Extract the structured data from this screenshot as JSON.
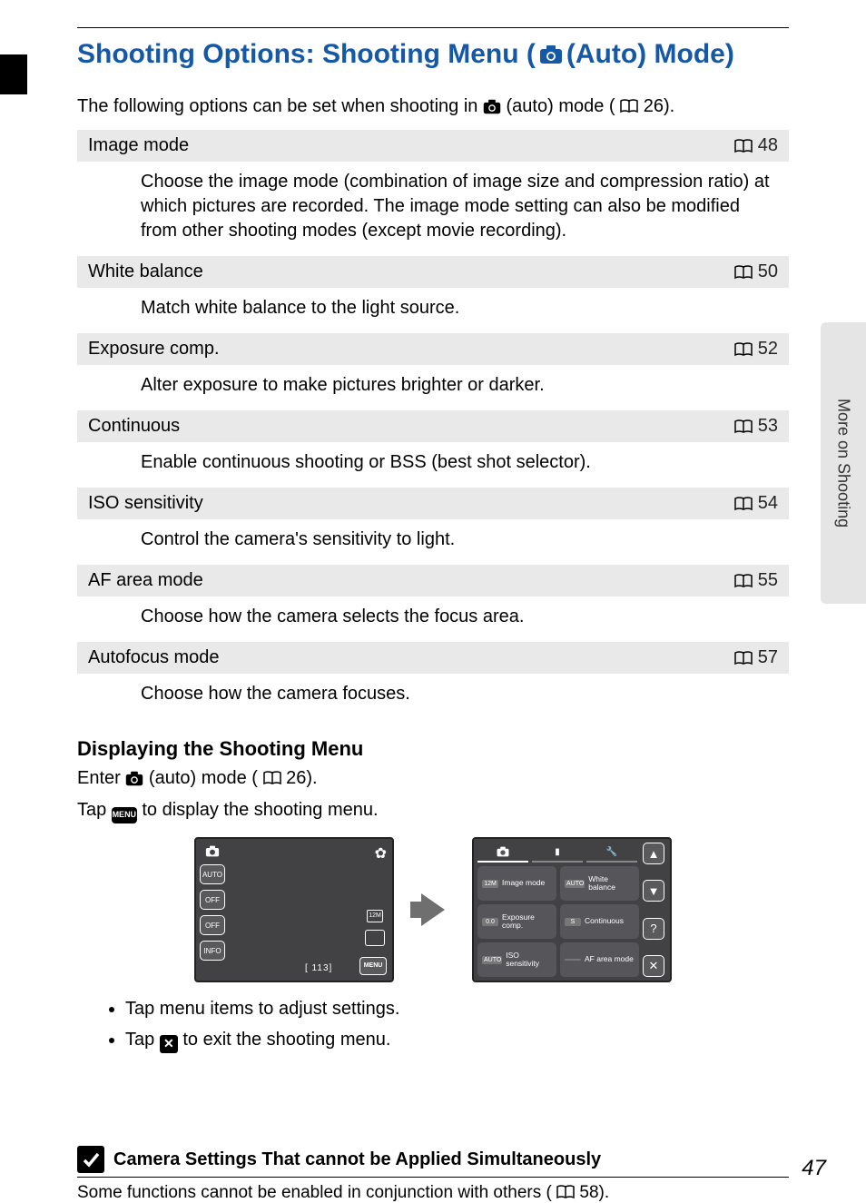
{
  "side_tab": "More on Shooting",
  "title_a": "Shooting Options: Shooting Menu (",
  "title_b": " (Auto) Mode)",
  "intro_a": "The following options can be set when shooting in ",
  "intro_b": " (auto) mode (",
  "intro_c": " 26).",
  "rows": [
    {
      "label": "Image mode",
      "page": "48",
      "desc": "Choose the image mode (combination of image size and compression ratio) at which pictures are recorded. The image mode setting can also be modified from other shooting modes (except movie recording)."
    },
    {
      "label": "White balance",
      "page": "50",
      "desc": "Match white balance to the light source."
    },
    {
      "label": "Exposure comp.",
      "page": "52",
      "desc": "Alter exposure to make pictures brighter or darker."
    },
    {
      "label": "Continuous",
      "page": "53",
      "desc": "Enable continuous shooting or BSS (best shot selector)."
    },
    {
      "label": "ISO sensitivity",
      "page": "54",
      "desc": "Control the camera's sensitivity to light."
    },
    {
      "label": "AF area mode",
      "page": "55",
      "desc": "Choose how the camera selects the focus area."
    },
    {
      "label": "Autofocus mode",
      "page": "57",
      "desc": "Choose how the camera focuses."
    }
  ],
  "sub_heading": "Displaying the Shooting Menu",
  "enter_a": "Enter ",
  "enter_b": " (auto) mode (",
  "enter_c": " 26).",
  "tap_a": "Tap ",
  "tap_b": " to display the shooting menu.",
  "menu_label": "MENU",
  "bullets": {
    "b1": "Tap menu items to adjust settings.",
    "b2_a": "Tap ",
    "b2_b": " to exit the shooting menu."
  },
  "screen1": {
    "sidebar": [
      "",
      "AUTO",
      "OFF",
      "OFF",
      "INFO"
    ],
    "r1": "12M",
    "r3": "MENU",
    "bl": "[   113]"
  },
  "screen2": {
    "cells": [
      {
        "ic": "12M",
        "lbl": "Image mode"
      },
      {
        "ic": "AUTO",
        "lbl": "White balance"
      },
      {
        "ic": "0.0",
        "lbl": "Exposure comp."
      },
      {
        "ic": "S",
        "lbl": "Continuous"
      },
      {
        "ic": "AUTO",
        "lbl": "ISO sensitivity"
      },
      {
        "ic": "",
        "lbl": "AF area mode"
      }
    ],
    "side": [
      "▲",
      "▼",
      "?",
      "✕"
    ]
  },
  "note": {
    "heading": "Camera Settings That cannot be Applied Simultaneously",
    "body_a": "Some functions cannot be enabled in conjunction with others (",
    "body_b": " 58)."
  },
  "page_number": "47"
}
